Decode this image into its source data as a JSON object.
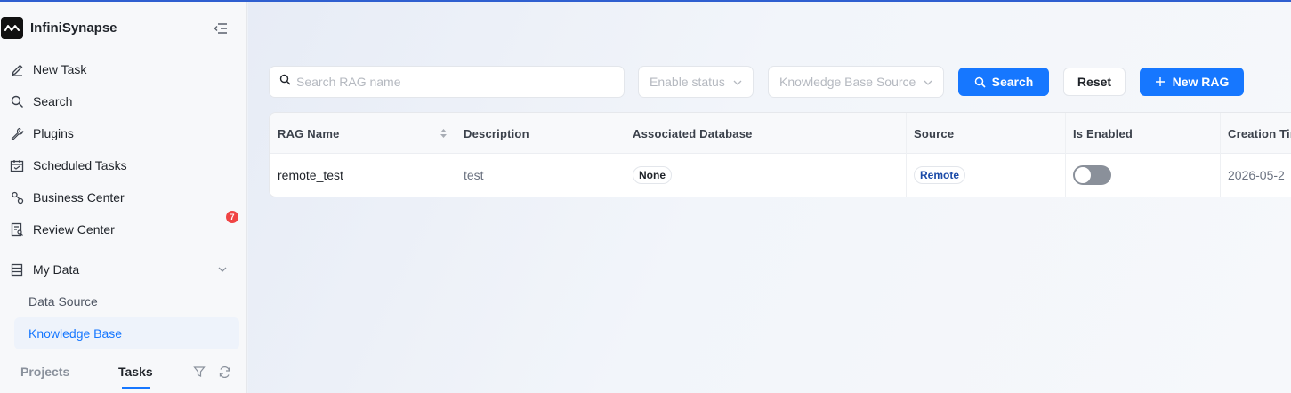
{
  "app": {
    "name": "InfiniSynapse"
  },
  "sidebar": {
    "items": [
      {
        "label": "New Task",
        "icon": "pencil-icon"
      },
      {
        "label": "Search",
        "icon": "search-icon"
      },
      {
        "label": "Plugins",
        "icon": "wrench-icon"
      },
      {
        "label": "Scheduled Tasks",
        "icon": "calendar-icon"
      },
      {
        "label": "Business Center",
        "icon": "business-icon"
      },
      {
        "label": "Review Center",
        "icon": "review-icon",
        "badge": "7"
      },
      {
        "label": "My Data",
        "icon": "database-icon"
      }
    ],
    "my_data_children": [
      {
        "label": "Data Source"
      },
      {
        "label": "Knowledge Base",
        "active": true
      }
    ],
    "tabs": {
      "projects": "Projects",
      "tasks": "Tasks",
      "active": "Tasks"
    }
  },
  "toolbar": {
    "search_placeholder": "Search RAG name",
    "enable_status_placeholder": "Enable status",
    "kb_source_placeholder": "Knowledge Base Source",
    "search_label": "Search",
    "reset_label": "Reset",
    "new_rag_label": "New RAG"
  },
  "table": {
    "columns": [
      "RAG Name",
      "Description",
      "Associated Database",
      "Source",
      "Is Enabled",
      "Creation Time"
    ],
    "rows": [
      {
        "rag_name": "remote_test",
        "description": "test",
        "associated_database": "None",
        "source": "Remote",
        "is_enabled": false,
        "creation_time": "2026-05-2"
      }
    ]
  },
  "colors": {
    "accent": "#1677ff",
    "badge": "#f04444",
    "toggle_off": "#8a909a"
  }
}
